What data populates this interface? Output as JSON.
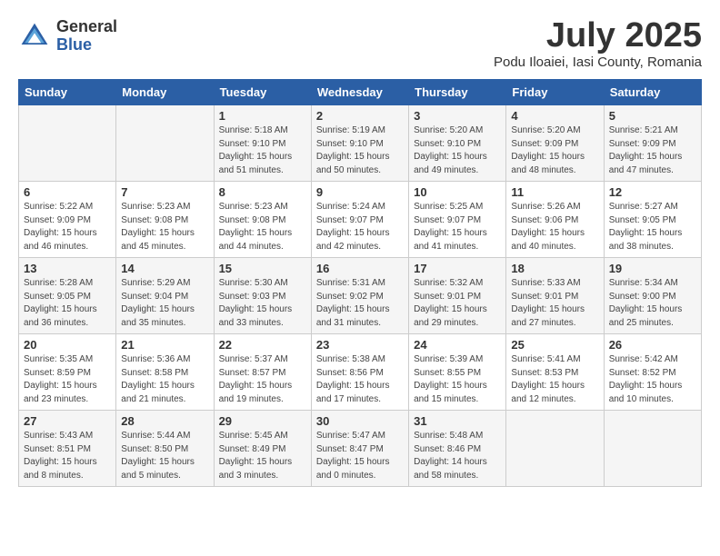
{
  "header": {
    "logo_general": "General",
    "logo_blue": "Blue",
    "month_title": "July 2025",
    "subtitle": "Podu Iloaiei, Iasi County, Romania"
  },
  "days_of_week": [
    "Sunday",
    "Monday",
    "Tuesday",
    "Wednesday",
    "Thursday",
    "Friday",
    "Saturday"
  ],
  "weeks": [
    [
      {
        "day": "",
        "info": ""
      },
      {
        "day": "",
        "info": ""
      },
      {
        "day": "1",
        "info": "Sunrise: 5:18 AM\nSunset: 9:10 PM\nDaylight: 15 hours\nand 51 minutes."
      },
      {
        "day": "2",
        "info": "Sunrise: 5:19 AM\nSunset: 9:10 PM\nDaylight: 15 hours\nand 50 minutes."
      },
      {
        "day": "3",
        "info": "Sunrise: 5:20 AM\nSunset: 9:10 PM\nDaylight: 15 hours\nand 49 minutes."
      },
      {
        "day": "4",
        "info": "Sunrise: 5:20 AM\nSunset: 9:09 PM\nDaylight: 15 hours\nand 48 minutes."
      },
      {
        "day": "5",
        "info": "Sunrise: 5:21 AM\nSunset: 9:09 PM\nDaylight: 15 hours\nand 47 minutes."
      }
    ],
    [
      {
        "day": "6",
        "info": "Sunrise: 5:22 AM\nSunset: 9:09 PM\nDaylight: 15 hours\nand 46 minutes."
      },
      {
        "day": "7",
        "info": "Sunrise: 5:23 AM\nSunset: 9:08 PM\nDaylight: 15 hours\nand 45 minutes."
      },
      {
        "day": "8",
        "info": "Sunrise: 5:23 AM\nSunset: 9:08 PM\nDaylight: 15 hours\nand 44 minutes."
      },
      {
        "day": "9",
        "info": "Sunrise: 5:24 AM\nSunset: 9:07 PM\nDaylight: 15 hours\nand 42 minutes."
      },
      {
        "day": "10",
        "info": "Sunrise: 5:25 AM\nSunset: 9:07 PM\nDaylight: 15 hours\nand 41 minutes."
      },
      {
        "day": "11",
        "info": "Sunrise: 5:26 AM\nSunset: 9:06 PM\nDaylight: 15 hours\nand 40 minutes."
      },
      {
        "day": "12",
        "info": "Sunrise: 5:27 AM\nSunset: 9:05 PM\nDaylight: 15 hours\nand 38 minutes."
      }
    ],
    [
      {
        "day": "13",
        "info": "Sunrise: 5:28 AM\nSunset: 9:05 PM\nDaylight: 15 hours\nand 36 minutes."
      },
      {
        "day": "14",
        "info": "Sunrise: 5:29 AM\nSunset: 9:04 PM\nDaylight: 15 hours\nand 35 minutes."
      },
      {
        "day": "15",
        "info": "Sunrise: 5:30 AM\nSunset: 9:03 PM\nDaylight: 15 hours\nand 33 minutes."
      },
      {
        "day": "16",
        "info": "Sunrise: 5:31 AM\nSunset: 9:02 PM\nDaylight: 15 hours\nand 31 minutes."
      },
      {
        "day": "17",
        "info": "Sunrise: 5:32 AM\nSunset: 9:01 PM\nDaylight: 15 hours\nand 29 minutes."
      },
      {
        "day": "18",
        "info": "Sunrise: 5:33 AM\nSunset: 9:01 PM\nDaylight: 15 hours\nand 27 minutes."
      },
      {
        "day": "19",
        "info": "Sunrise: 5:34 AM\nSunset: 9:00 PM\nDaylight: 15 hours\nand 25 minutes."
      }
    ],
    [
      {
        "day": "20",
        "info": "Sunrise: 5:35 AM\nSunset: 8:59 PM\nDaylight: 15 hours\nand 23 minutes."
      },
      {
        "day": "21",
        "info": "Sunrise: 5:36 AM\nSunset: 8:58 PM\nDaylight: 15 hours\nand 21 minutes."
      },
      {
        "day": "22",
        "info": "Sunrise: 5:37 AM\nSunset: 8:57 PM\nDaylight: 15 hours\nand 19 minutes."
      },
      {
        "day": "23",
        "info": "Sunrise: 5:38 AM\nSunset: 8:56 PM\nDaylight: 15 hours\nand 17 minutes."
      },
      {
        "day": "24",
        "info": "Sunrise: 5:39 AM\nSunset: 8:55 PM\nDaylight: 15 hours\nand 15 minutes."
      },
      {
        "day": "25",
        "info": "Sunrise: 5:41 AM\nSunset: 8:53 PM\nDaylight: 15 hours\nand 12 minutes."
      },
      {
        "day": "26",
        "info": "Sunrise: 5:42 AM\nSunset: 8:52 PM\nDaylight: 15 hours\nand 10 minutes."
      }
    ],
    [
      {
        "day": "27",
        "info": "Sunrise: 5:43 AM\nSunset: 8:51 PM\nDaylight: 15 hours\nand 8 minutes."
      },
      {
        "day": "28",
        "info": "Sunrise: 5:44 AM\nSunset: 8:50 PM\nDaylight: 15 hours\nand 5 minutes."
      },
      {
        "day": "29",
        "info": "Sunrise: 5:45 AM\nSunset: 8:49 PM\nDaylight: 15 hours\nand 3 minutes."
      },
      {
        "day": "30",
        "info": "Sunrise: 5:47 AM\nSunset: 8:47 PM\nDaylight: 15 hours\nand 0 minutes."
      },
      {
        "day": "31",
        "info": "Sunrise: 5:48 AM\nSunset: 8:46 PM\nDaylight: 14 hours\nand 58 minutes."
      },
      {
        "day": "",
        "info": ""
      },
      {
        "day": "",
        "info": ""
      }
    ]
  ]
}
